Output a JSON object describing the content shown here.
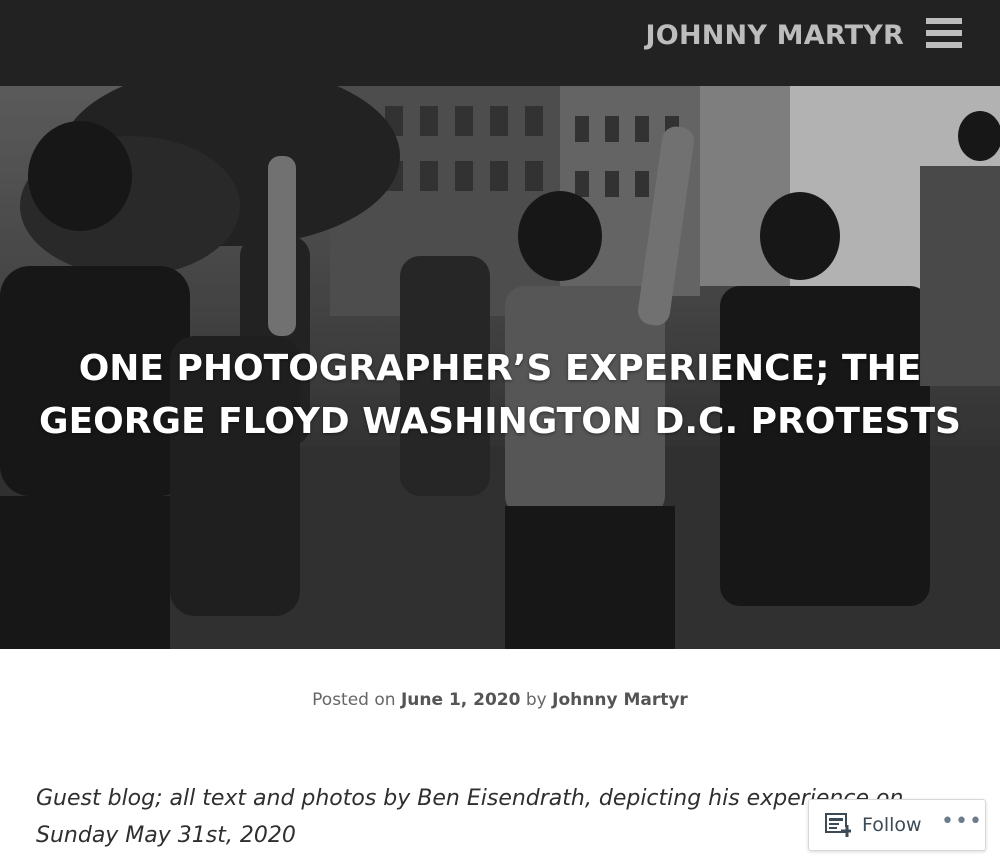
{
  "header": {
    "site_title": "JOHNNY MARTYR",
    "menu_icon": "hamburger-menu-icon"
  },
  "hero": {
    "title": "ONE PHOTOGRAPHER’S EXPERIENCE; THE GEORGE FLOYD WASHINGTON D.C. PROTESTS"
  },
  "post_meta": {
    "prefix": "Posted on",
    "date": "June 1, 2020",
    "by": "by",
    "author": "Johnny Martyr"
  },
  "intro": {
    "text": "Guest blog; all text and photos by Ben Eisendrath, depicting his experience on Sunday May 31st, 2020"
  },
  "follow_widget": {
    "follow_label": "Follow",
    "more_label": "•••",
    "follow_icon": "reader-follow-icon",
    "accent_color": "#3c4a55"
  },
  "colors": {
    "topbar": "#222222",
    "title_text": "#bdbdbd"
  }
}
